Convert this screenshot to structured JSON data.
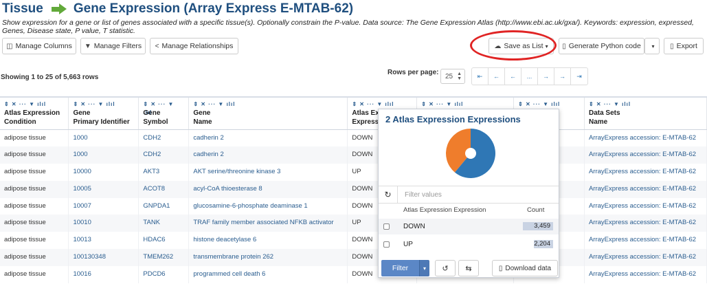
{
  "header": {
    "title_left": "Tissue",
    "title_right": "Gene Expression (Array Express E-MTAB-62)",
    "description": "Show expression for a gene or list of genes associated with a specific tissue(s). Optionally constrain the P-value. Data source: The Gene Expression Atlas (http://www.ebi.ac.uk/gxa/). Keywords: expression, expressed, Genes, Disease state, P value, T statistic."
  },
  "toolbar": {
    "manage_columns": "Manage Columns",
    "manage_filters": "Manage Filters",
    "manage_relationships": "Manage Relationships",
    "save_as_list": "Save as List",
    "generate_python": "Generate Python code",
    "export": "Export"
  },
  "table_meta": {
    "showing": "Showing 1 to 25 of 5,663 rows",
    "rows_per_page_label": "Rows per page:",
    "rows_per_page_value": "25",
    "pager": [
      "⇤",
      "←",
      "←",
      "...",
      "→",
      "→",
      "⇥"
    ]
  },
  "columns": [
    {
      "line1": "Atlas Expression",
      "line2": "Condition"
    },
    {
      "line1": "Gene",
      "line2": "Primary Identifier"
    },
    {
      "line1": "Gene",
      "line2": "Symbol"
    },
    {
      "line1": "Gene",
      "line2": "Name"
    },
    {
      "line1": "Atlas Ex",
      "line2": "Expressi"
    },
    {
      "line1": "",
      "line2": ""
    },
    {
      "line1": "",
      "line2": "ion"
    },
    {
      "line1": "Data Sets",
      "line2": "Name"
    }
  ],
  "column_controls": "⇕ ✕ ··· ▼ ılıl",
  "rows": [
    [
      "adipose tissue",
      "1000",
      "CDH2",
      "cadherin 2",
      "DOWN",
      "",
      "",
      "ArrayExpress accession: E-MTAB-62"
    ],
    [
      "adipose tissue",
      "1000",
      "CDH2",
      "cadherin 2",
      "DOWN",
      "",
      "",
      "ArrayExpress accession: E-MTAB-62"
    ],
    [
      "adipose tissue",
      "10000",
      "AKT3",
      "AKT serine/threonine kinase 3",
      "UP",
      "",
      "",
      "ArrayExpress accession: E-MTAB-62"
    ],
    [
      "adipose tissue",
      "10005",
      "ACOT8",
      "acyl-CoA thioesterase 8",
      "DOWN",
      "",
      "",
      "ArrayExpress accession: E-MTAB-62"
    ],
    [
      "adipose tissue",
      "10007",
      "GNPDA1",
      "glucosamine-6-phosphate deaminase 1",
      "DOWN",
      "",
      "",
      "ArrayExpress accession: E-MTAB-62"
    ],
    [
      "adipose tissue",
      "10010",
      "TANK",
      "TRAF family member associated NFKB activator",
      "UP",
      "",
      "",
      "ArrayExpress accession: E-MTAB-62"
    ],
    [
      "adipose tissue",
      "10013",
      "HDAC6",
      "histone deacetylase 6",
      "DOWN",
      "",
      "",
      "ArrayExpress accession: E-MTAB-62"
    ],
    [
      "adipose tissue",
      "100130348",
      "TMEM262",
      "transmembrane protein 262",
      "DOWN",
      "",
      "",
      "ArrayExpress accession: E-MTAB-62"
    ],
    [
      "adipose tissue",
      "10016",
      "PDCD6",
      "programmed cell death 6",
      "DOWN",
      "",
      "",
      "ArrayExpress accession: E-MTAB-62"
    ]
  ],
  "popup": {
    "title": "2 Atlas Expression Expressions",
    "filter_placeholder": "Filter values",
    "col_value": "Atlas Expression Expression",
    "col_count": "Count",
    "items": [
      {
        "label": "DOWN",
        "count": "3,459",
        "value": 3459,
        "color": "#2f77b5"
      },
      {
        "label": "UP",
        "count": "2,204",
        "value": 2204,
        "color": "#ef7d2c"
      }
    ],
    "filter_button": "Filter",
    "download_button": "Download data"
  },
  "colors": {
    "title": "#1f4f7f",
    "arrow": "#62a93a",
    "highlight": "#e02424"
  }
}
